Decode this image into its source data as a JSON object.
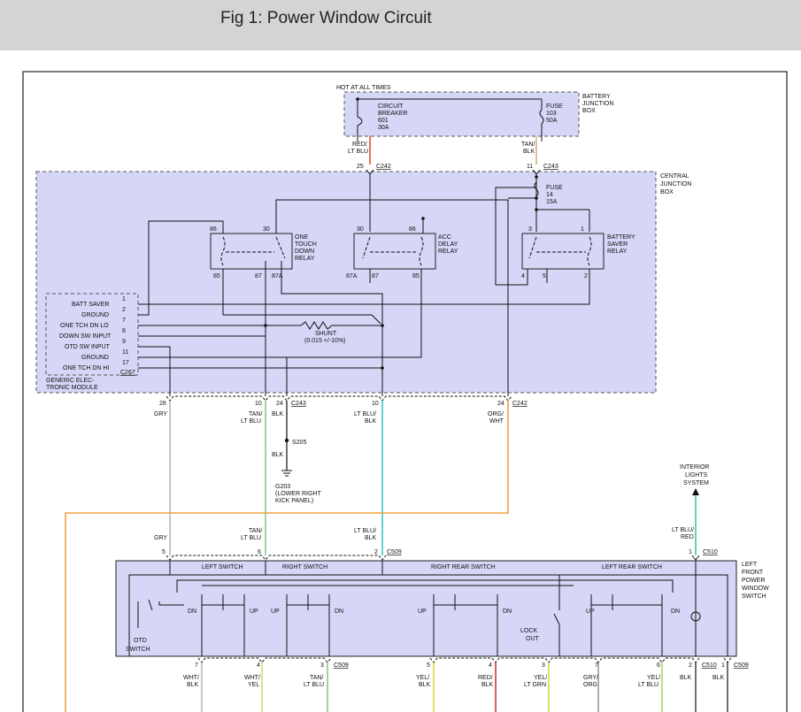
{
  "page": {
    "title": "Fig 1: Power Window Circuit"
  },
  "battery_box": {
    "hot": "HOT AT ALL TIMES",
    "name": [
      "BATTERY",
      "JUNCTION",
      "BOX"
    ],
    "breaker": [
      "CIRCUIT",
      "BREAKER",
      "601",
      "30A"
    ],
    "fuse": [
      "FUSE",
      "103",
      "50A"
    ]
  },
  "wires_top": {
    "left": {
      "color": [
        "RED/",
        "LT BLU"
      ],
      "pin": "25",
      "conn": "C242"
    },
    "right": {
      "color": [
        "TAN/",
        "BLK"
      ],
      "pin": "11",
      "conn": "C243"
    }
  },
  "cjb": {
    "name": [
      "CENTRAL",
      "JUNCTION",
      "BOX"
    ],
    "fuse": [
      "FUSE",
      "14",
      "15A"
    ],
    "relay_otd": {
      "name": [
        "ONE",
        "TOUCH",
        "DOWN",
        "RELAY"
      ],
      "pins_top": [
        "86",
        "30"
      ],
      "pins_bot": [
        "85",
        "87",
        "87A"
      ]
    },
    "relay_acc": {
      "name": [
        "ACC",
        "DELAY",
        "RELAY"
      ],
      "pins_top": [
        "30",
        "86"
      ],
      "pins_bot": [
        "87A",
        "87",
        "85"
      ]
    },
    "relay_bat": {
      "name": [
        "BATTERY",
        "SAVER",
        "RELAY"
      ],
      "pins_top": [
        "3",
        "1"
      ],
      "pins_bot": [
        "4",
        "5",
        "2"
      ]
    },
    "shunt": [
      "SHUNT",
      "(0.015 +/-10%)"
    ]
  },
  "gem": {
    "name": [
      "GENERIC ELEC-",
      "TRONIC MODULE"
    ],
    "conn": "C267",
    "pins": [
      {
        "label": "BATT SAVER",
        "num": "1"
      },
      {
        "label": "GROUND",
        "num": "2"
      },
      {
        "label": "ONE TCH DN LO",
        "num": "7"
      },
      {
        "label": "DOWN SW INPUT",
        "num": "8"
      },
      {
        "label": "OTD SW INPUT",
        "num": "9"
      },
      {
        "label": "GROUND",
        "num": "11"
      },
      {
        "label": "ONE TCH DN HI",
        "num": "17"
      }
    ]
  },
  "mid_wires": {
    "gry": {
      "pin": "28",
      "color": [
        "GRY"
      ]
    },
    "tan_ltblu": {
      "pin": "10",
      "color": [
        "TAN/",
        "LT BLU"
      ]
    },
    "blk": {
      "pin": "24",
      "color": [
        "BLK"
      ],
      "conn": "C243"
    },
    "ltblu_blk": {
      "pin": "10",
      "color": [
        "LT BLU/",
        "BLK"
      ]
    },
    "org_wht": {
      "pin": "24",
      "color": [
        "ORG/",
        "WHT"
      ],
      "conn": "C242"
    },
    "splice": "S205",
    "blk2": "BLK",
    "ground": [
      "G203",
      "(LOWER RIGHT",
      "KICK PANEL)"
    ]
  },
  "interior": [
    "INTERIOR",
    "LIGHTS",
    "SYSTEM"
  ],
  "lf_switch": {
    "name": [
      "LEFT",
      "FRONT",
      "POWER",
      "WINDOW",
      "SWITCH"
    ],
    "sections": [
      "LEFT SWITCH",
      "RIGHT SWITCH",
      "RIGHT REAR SWITCH",
      "LEFT REAR SWITCH"
    ],
    "otd": [
      "OTD",
      "SWITCH"
    ],
    "lock": [
      "LOCK",
      "OUT"
    ],
    "dn": "DN",
    "up": "UP",
    "in_wires": [
      {
        "color": [
          "GRY"
        ],
        "pin": "5"
      },
      {
        "color": [
          "TAN/",
          "LT BLU"
        ],
        "pin": "6"
      },
      {
        "color": [
          "LT BLU/",
          "BLK"
        ],
        "pin": "2",
        "conn": "C509"
      },
      {
        "color": [
          "LT BLU/",
          "RED"
        ],
        "pin": "1",
        "conn": "C510"
      }
    ],
    "out_wires": [
      {
        "pin": "7",
        "color": [
          "WHT/",
          "BLK"
        ]
      },
      {
        "pin": "4",
        "color": [
          "WHT/",
          "YEL"
        ]
      },
      {
        "pin": "3",
        "color": [
          "TAN/",
          "LT BLU"
        ],
        "conn": "C509"
      },
      {
        "pin": "5",
        "color": [
          "YEL/",
          "BLK"
        ]
      },
      {
        "pin": "4",
        "color": [
          "RED/",
          "BLK"
        ]
      },
      {
        "pin": "3",
        "color": [
          "YEL/",
          "LT GRN"
        ]
      },
      {
        "pin": "7",
        "color": [
          "GRY/",
          "ORG"
        ]
      },
      {
        "pin": "6",
        "color": [
          "YEL/",
          "LT BLU"
        ]
      },
      {
        "pin": "2",
        "color": [
          "BLK"
        ],
        "conn": "C510"
      },
      {
        "pin": "1",
        "color": [
          "BLK"
        ],
        "conn": "C509"
      }
    ]
  }
}
